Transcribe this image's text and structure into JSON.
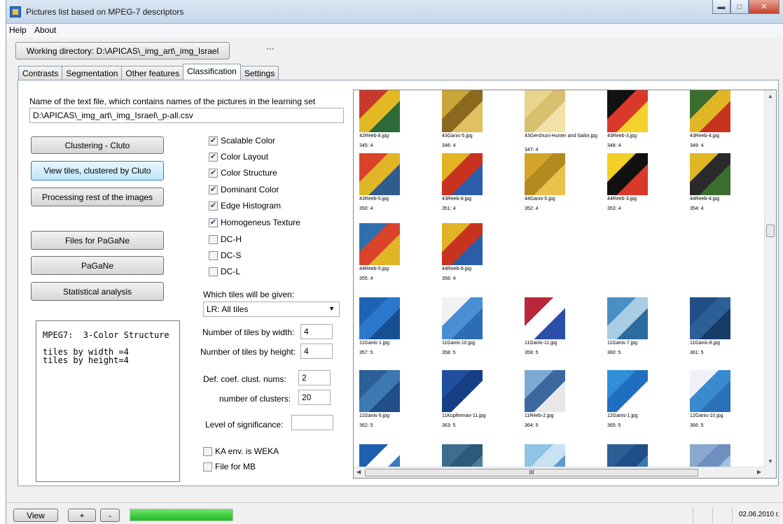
{
  "window": {
    "title": "Pictures list   based on MPEG-7 descriptors"
  },
  "menu": [
    "Help",
    "About"
  ],
  "toolbar": {
    "working_dir": "Working directory: D:\\APICAS\\_img_art\\_img_Israel",
    "more": "···"
  },
  "tabs": [
    {
      "label": "Contrasts",
      "active": false
    },
    {
      "label": "Segmentation",
      "active": false
    },
    {
      "label": "Other features",
      "active": false
    },
    {
      "label": "Classification",
      "active": true
    },
    {
      "label": "Settings",
      "active": false
    }
  ],
  "classification": {
    "textfile_label": "Name of the text file, which contains names of the pictures in the learning set",
    "textfile_value": "D:\\APICAS\\_img_art\\_img_Israel\\_p-all.csv",
    "buttons": {
      "clustering": "Clustering - Cluto",
      "view_tiles": "View tiles, clustered by Cluto",
      "processing_rest": "Processing rest of the images",
      "files_pagane": "Files for PaGaNe",
      "pagane": "PaGaNe",
      "statistical": "Statistical analysis"
    },
    "info_text": "MPEG7:  3-Color Structure\n\ntiles by width =4\ntiles by height=4",
    "descriptors": [
      {
        "label": "Scalable Color",
        "checked": true
      },
      {
        "label": "Color Layout",
        "checked": true
      },
      {
        "label": "Color Structure",
        "checked": true
      },
      {
        "label": "Dominant Color",
        "checked": true
      },
      {
        "label": "Edge Histogram",
        "checked": true
      },
      {
        "label": "Homogeneus Texture",
        "checked": true
      },
      {
        "label": "DC-H",
        "checked": false
      },
      {
        "label": "DC-S",
        "checked": false
      },
      {
        "label": "DC-L",
        "checked": false
      }
    ],
    "tiles_label": "Which tiles will be given:",
    "tiles_select": "LR: All tiles",
    "num_tiles_width_label": "Number of tiles by width:",
    "num_tiles_width": "4",
    "num_tiles_height_label": "Number of tiles by height:",
    "num_tiles_height": "4",
    "def_coef_label": "Def. coef. clust. nums:",
    "def_coef": "2",
    "num_clusters_label": "number of clusters:",
    "num_clusters": "20",
    "significance_label": "Level of significance:",
    "significance": "",
    "ka_weka": {
      "label": "KA env. is WEKA",
      "checked": false
    },
    "file_mb": {
      "label": "File for MB",
      "checked": false
    }
  },
  "gallery": [
    {
      "file": "42Reeb-8.jpg",
      "idx": "345: 4",
      "palette": [
        "#c9392b",
        "#e2b824",
        "#2c6a3a"
      ]
    },
    {
      "file": "43Ganis-5.jpg",
      "idx": "346: 4",
      "palette": [
        "#c9a53a",
        "#8a6a1e",
        "#e0c060"
      ]
    },
    {
      "file": "43Gershuni-Hunter and Sailor.jpg",
      "idx": "347: 4",
      "palette": [
        "#e8d48c",
        "#d9c070",
        "#f0e2a8"
      ]
    },
    {
      "file": "43Reeb-3.jpg",
      "idx": "348: 4",
      "palette": [
        "#111111",
        "#d8392b",
        "#f4d22b"
      ]
    },
    {
      "file": "43Reeb-4.jpg",
      "idx": "349: 4",
      "palette": [
        "#3b6e2e",
        "#e0b526",
        "#c8331f"
      ]
    },
    {
      "file": "43Reeb-5.jpg",
      "idx": "350: 4",
      "palette": [
        "#d9432a",
        "#e0b526",
        "#2f5b8f"
      ]
    },
    {
      "file": "43Reeb-8.jpg",
      "idx": "351: 4",
      "palette": [
        "#e2b324",
        "#c8331f",
        "#2b5ea8"
      ]
    },
    {
      "file": "44Ganis-5.jpg",
      "idx": "352: 4",
      "palette": [
        "#d2a52a",
        "#b38a1e",
        "#e8c24a"
      ]
    },
    {
      "file": "44Reeb-3.jpg",
      "idx": "353: 4",
      "palette": [
        "#f2d024",
        "#111111",
        "#d8392b"
      ]
    },
    {
      "file": "44Reeb-4.jpg",
      "idx": "354: 4",
      "palette": [
        "#e0b526",
        "#2a2a2a",
        "#3b6e2e"
      ]
    },
    {
      "file": "44Reeb-5.jpg",
      "idx": "355: 4",
      "palette": [
        "#2f6fb0",
        "#d9432a",
        "#e0b526"
      ]
    },
    {
      "file": "44Reeb-8.jpg",
      "idx": "356: 4",
      "palette": [
        "#e2b324",
        "#c8331f",
        "#2b5ea8"
      ]
    },
    {
      "file": "11Ganis-1.jpg",
      "idx": "357: 5",
      "palette": [
        "#1f63b5",
        "#2a78cc",
        "#174f94"
      ]
    },
    {
      "file": "11Ganis-10.jpg",
      "idx": "358: 5",
      "palette": [
        "#f2f2f2",
        "#4a8fd4",
        "#2d6db3"
      ]
    },
    {
      "file": "11Ganis-11.jpg",
      "idx": "359: 5",
      "palette": [
        "#b8283a",
        "#ffffff",
        "#2b4fa8"
      ]
    },
    {
      "file": "11Ganis-7.jpg",
      "idx": "360: 5",
      "palette": [
        "#4a8fc4",
        "#a8cde4",
        "#2d6aa0"
      ]
    },
    {
      "file": "11Ganis-8.jpg",
      "idx": "361: 5",
      "palette": [
        "#1f4f86",
        "#2c5f96",
        "#163c68"
      ]
    },
    {
      "file": "11Ganis-9.jpg",
      "idx": "362: 5",
      "palette": [
        "#2c5f96",
        "#3c78b2",
        "#1f4f86"
      ]
    },
    {
      "file": "11Kupferman-11.jpg",
      "idx": "363: 5",
      "palette": [
        "#1f4f9e",
        "#173f86",
        "#ffffff"
      ]
    },
    {
      "file": "11Reeb-2.jpg",
      "idx": "364: 5",
      "palette": [
        "#7ea8d4",
        "#3c68a0",
        "#e8e8e8"
      ]
    },
    {
      "file": "12Ganis-1.jpg",
      "idx": "365: 5",
      "palette": [
        "#2f8fd8",
        "#1f6fc0",
        "#ffffff"
      ]
    },
    {
      "file": "12Ganis-10.jpg",
      "idx": "366: 5",
      "palette": [
        "#eef2f6",
        "#3a8ad0",
        "#2a70b8"
      ]
    },
    {
      "file": "",
      "idx": "",
      "palette": [
        "#1f5fb0",
        "#ffffff",
        "#3a78c0"
      ]
    },
    {
      "file": "",
      "idx": "",
      "palette": [
        "#3d6e8e",
        "#2c5a78",
        "#4a7ea0"
      ]
    },
    {
      "file": "",
      "idx": "",
      "palette": [
        "#8fc4e4",
        "#c8e2f2",
        "#5a9ccc"
      ]
    },
    {
      "file": "",
      "idx": "",
      "palette": [
        "#2c5f96",
        "#1f4f86",
        "#3c78b2"
      ]
    },
    {
      "file": "",
      "idx": "",
      "palette": [
        "#8aa8d0",
        "#6e90c0",
        "#a8c0e0"
      ]
    }
  ],
  "scrollbar": {
    "h_thumb_grip": "III"
  },
  "statusbar": {
    "view": "View",
    "plus": "+",
    "minus": "-",
    "progress": 1.0,
    "date": "02.06.2010 г."
  }
}
